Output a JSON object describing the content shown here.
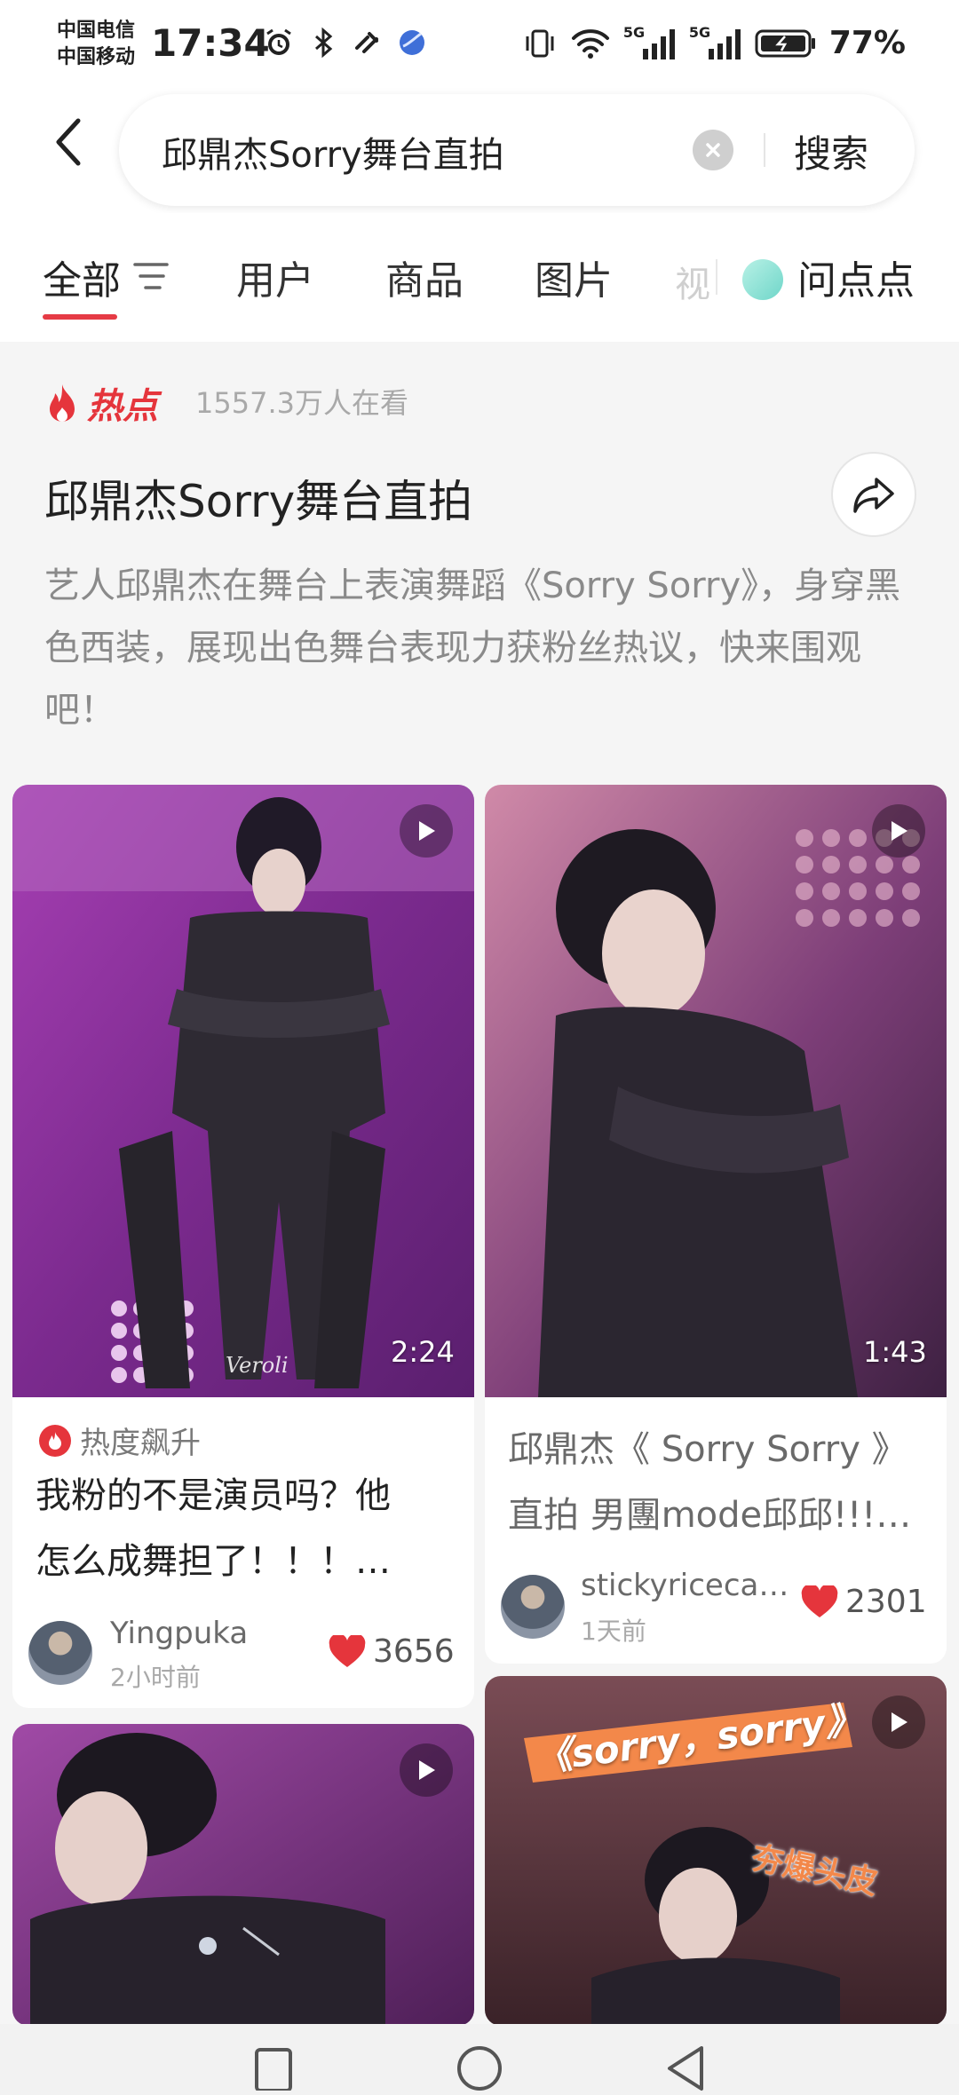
{
  "status_bar": {
    "carrier_1": "中国电信",
    "carrier_2": "中国移动",
    "time": "17:34",
    "battery": "77%",
    "network_1": "5G",
    "network_2": "5G"
  },
  "search": {
    "query": "邱鼎杰Sorry舞台直拍",
    "button": "搜索"
  },
  "tabs": [
    {
      "label": "全部"
    },
    {
      "label": "用户"
    },
    {
      "label": "商品"
    },
    {
      "label": "图片"
    }
  ],
  "tab_extra": {
    "partial": "视",
    "wdd": "问点点"
  },
  "hot": {
    "label": "热点",
    "viewers": "1557.3万人在看",
    "title": "邱鼎杰Sorry舞台直拍",
    "description": "艺人邱鼎杰在舞台上表演舞蹈《Sorry Sorry》，身穿黑色西装，展现出色舞台表现力获粉丝热议，快来围观吧！"
  },
  "cards": [
    {
      "duration": "2:24",
      "watermark": "Veroli",
      "trend": "热度飙升",
      "title_1": "我粉的不是演员吗？他",
      "title_2": "怎么成舞担了！！！…",
      "author": "Yingpuka",
      "time": "2小时前",
      "likes": "3656"
    },
    {
      "duration": "1:43",
      "title_1": "邱鼎杰《 Sorry Sorry 》",
      "title_2": "直拍 男團mode邱邱!!!…",
      "author": "stickyriceca…",
      "time": "1天前",
      "likes": "2301"
    },
    {
      "duration": ""
    },
    {
      "banner": "《sorry，sorry》",
      "sticker": "夯爆头皮"
    }
  ],
  "colors": {
    "accent": "#e63b45",
    "like_heart": "#e5353c",
    "stage_purple": "#8d2f9e",
    "stage_pink": "#c8749a"
  },
  "icons": [
    "back-icon",
    "clear-icon",
    "filter-icon",
    "fire-icon",
    "share-icon",
    "play-icon",
    "heart-icon",
    "alarm-icon",
    "bluetooth-icon",
    "nfc-icon",
    "vibrate-icon",
    "wifi-icon",
    "signal-icon",
    "battery-icon"
  ]
}
